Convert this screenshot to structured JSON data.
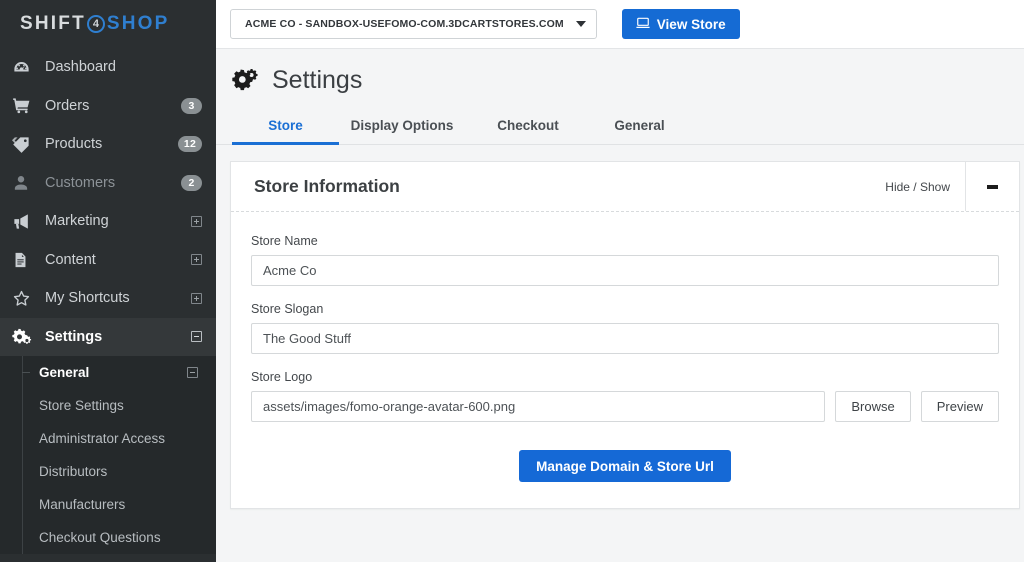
{
  "brand": {
    "logo_part1": "SHIFT",
    "logo_badge": "4",
    "logo_part2": "SHOP",
    "accent_blue": "#2f7fd0"
  },
  "sidebar": {
    "items": [
      {
        "label": "Dashboard",
        "icon": "speedometer-icon",
        "badge": null,
        "expander": null
      },
      {
        "label": "Orders",
        "icon": "cart-icon",
        "badge": "3",
        "expander": null
      },
      {
        "label": "Products",
        "icon": "tag-icon",
        "badge": "12",
        "expander": null
      },
      {
        "label": "Customers",
        "icon": "user-icon",
        "badge": "2",
        "expander": null
      },
      {
        "label": "Marketing",
        "icon": "megaphone-icon",
        "badge": null,
        "expander": "plus"
      },
      {
        "label": "Content",
        "icon": "document-icon",
        "badge": null,
        "expander": "plus"
      },
      {
        "label": "My Shortcuts",
        "icon": "star-icon",
        "badge": null,
        "expander": "plus"
      },
      {
        "label": "Settings",
        "icon": "gears-icon",
        "badge": null,
        "expander": "minus"
      }
    ],
    "submenu": [
      {
        "label": "General",
        "expander": "minus",
        "active": true
      },
      {
        "label": "Store Settings",
        "expander": null,
        "active": false
      },
      {
        "label": "Administrator Access",
        "expander": null,
        "active": false
      },
      {
        "label": "Distributors",
        "expander": null,
        "active": false
      },
      {
        "label": "Manufacturers",
        "expander": null,
        "active": false
      },
      {
        "label": "Checkout Questions",
        "expander": null,
        "active": false
      }
    ]
  },
  "topbar": {
    "store_selector_value": "ACME CO - SANDBOX-USEFOMO-COM.3DCARTSTORES.COM",
    "view_store_label": "View Store",
    "view_store_icon": "monitor-icon",
    "view_store_color": "#156bd4"
  },
  "page": {
    "title": "Settings",
    "title_icon": "gears-icon",
    "tabs": [
      {
        "label": "Store",
        "active": true
      },
      {
        "label": "Display Options",
        "active": false
      },
      {
        "label": "Checkout",
        "active": false
      },
      {
        "label": "General",
        "active": false
      }
    ],
    "active_tab_color": "#1a6fd4"
  },
  "panel": {
    "title": "Store Information",
    "hide_show_label": "Hide / Show",
    "collapse_icon": "minus-icon",
    "fields": {
      "store_name_label": "Store Name",
      "store_name_value": "Acme Co",
      "store_slogan_label": "Store Slogan",
      "store_slogan_value": "The Good Stuff",
      "store_logo_label": "Store Logo",
      "store_logo_value": "assets/images/fomo-orange-avatar-600.png",
      "browse_label": "Browse",
      "preview_label": "Preview"
    },
    "primary_action_label": "Manage Domain & Store Url",
    "primary_action_color": "#1569d6"
  }
}
